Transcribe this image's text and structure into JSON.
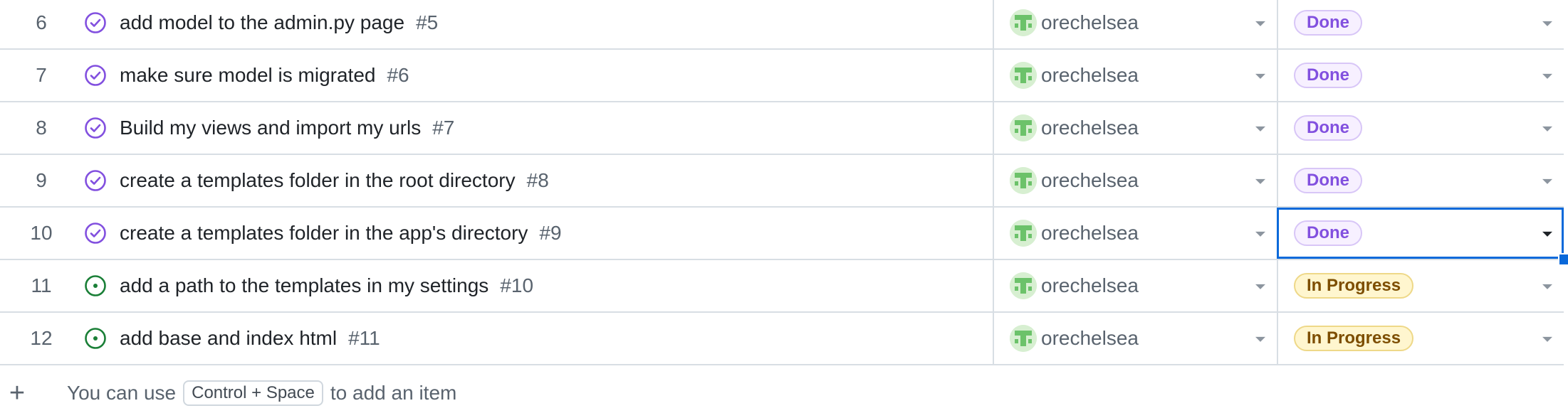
{
  "rows": [
    {
      "num": "6",
      "title": "add model to the admin.py page",
      "issue": "#5",
      "assignee": "orechelsea",
      "status": "Done",
      "state": "closed"
    },
    {
      "num": "7",
      "title": "make sure model is migrated",
      "issue": "#6",
      "assignee": "orechelsea",
      "status": "Done",
      "state": "closed"
    },
    {
      "num": "8",
      "title": "Build my views and import my urls",
      "issue": "#7",
      "assignee": "orechelsea",
      "status": "Done",
      "state": "closed"
    },
    {
      "num": "9",
      "title": "create a templates folder in the root directory",
      "issue": "#8",
      "assignee": "orechelsea",
      "status": "Done",
      "state": "closed"
    },
    {
      "num": "10",
      "title": "create a templates folder in the app's directory",
      "issue": "#9",
      "assignee": "orechelsea",
      "status": "Done",
      "state": "closed",
      "selected": true
    },
    {
      "num": "11",
      "title": "add a path to the templates in my settings",
      "issue": "#10",
      "assignee": "orechelsea",
      "status": "In Progress",
      "state": "open"
    },
    {
      "num": "12",
      "title": "add base and index html",
      "issue": "#11",
      "assignee": "orechelsea",
      "status": "In Progress",
      "state": "open"
    }
  ],
  "footer": {
    "plus_icon": "plus-icon",
    "hint_before": "You can use",
    "shortcut": "Control + Space",
    "hint_after": "to add an item"
  },
  "colors": {
    "done_bg": "#f7f0ff",
    "done_fg": "#8250df",
    "progress_bg": "#fff6cf",
    "progress_fg": "#7d4e00",
    "closed_icon": "#8250df",
    "open_icon": "#1a7f37",
    "selection": "#0969da"
  }
}
